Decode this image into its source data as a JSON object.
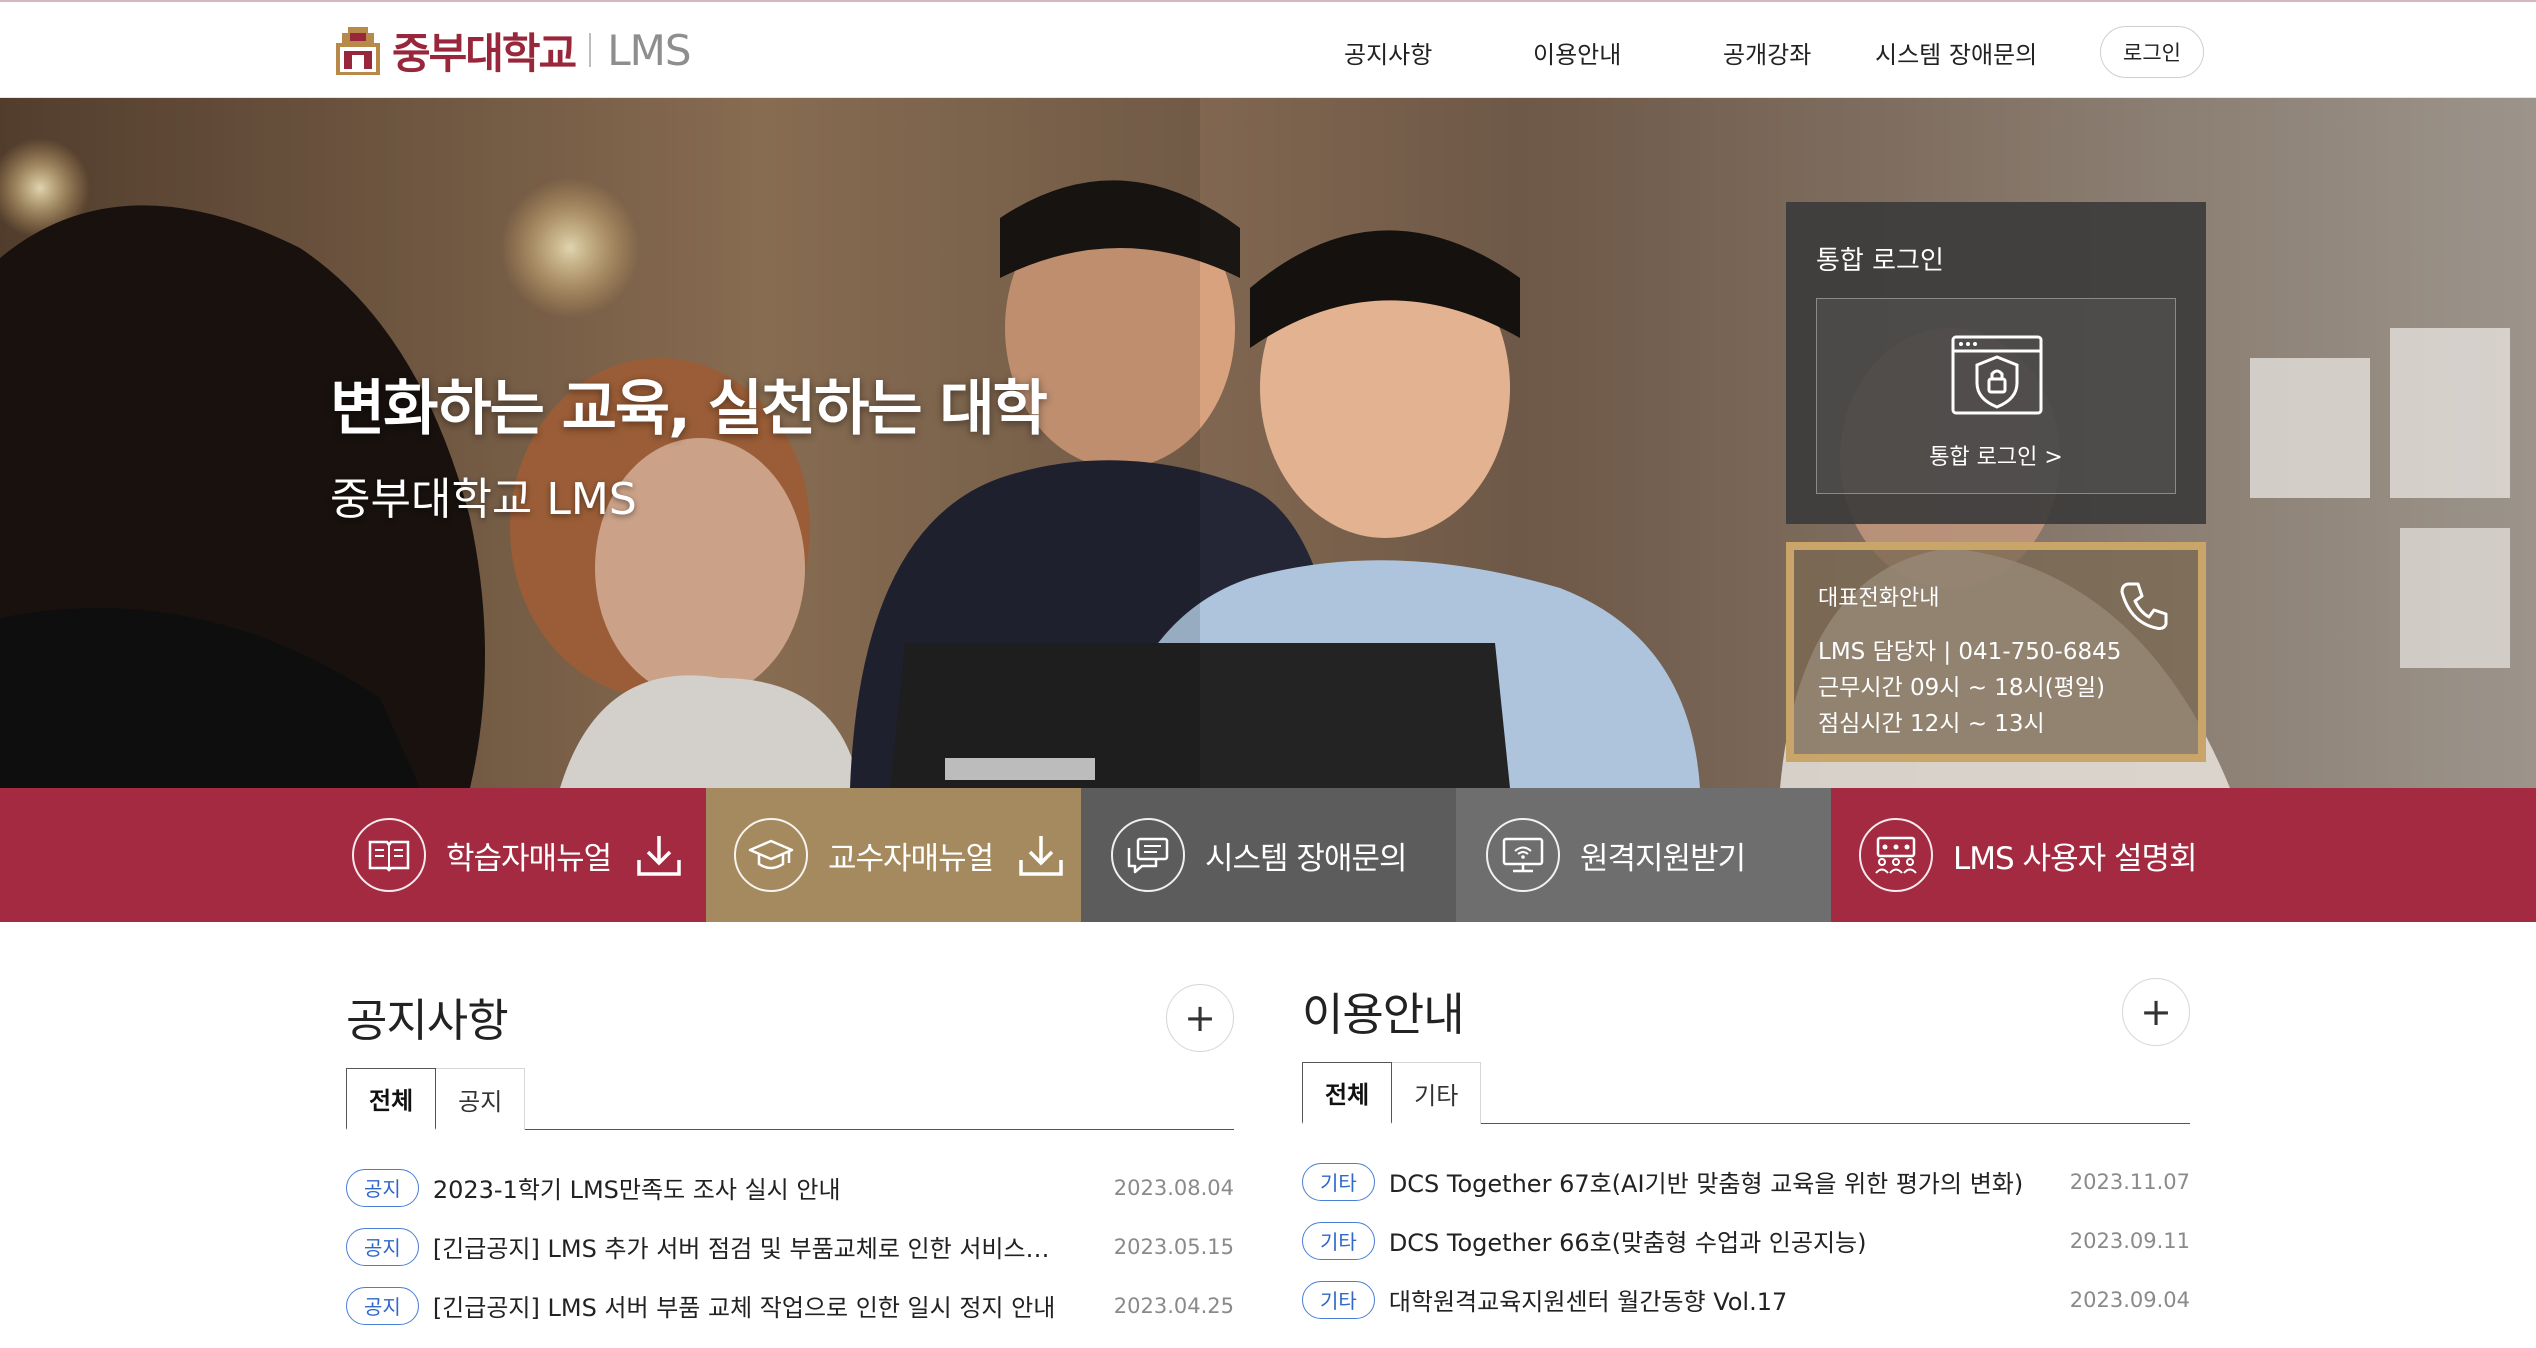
{
  "header": {
    "logo_name": "중부대학교",
    "logo_lms": "LMS",
    "nav": [
      {
        "label": "공지사항"
      },
      {
        "label": "이용안내"
      },
      {
        "label": "공개강좌"
      },
      {
        "label": "시스템 장애문의"
      }
    ],
    "login_button": "로그인"
  },
  "hero": {
    "title": "변화하는 교육, 실천하는 대학",
    "subtitle": "중부대학교 LMS",
    "login_box": {
      "title": "통합 로그인",
      "button_label": "통합 로그인 >"
    },
    "phone_box": {
      "title": "대표전화안내",
      "lines": [
        "LMS 담당자 | 041-750-6845",
        "근무시간 09시 ~ 18시(평일)",
        "점심시간 12시 ~ 13시"
      ]
    }
  },
  "quick_links": [
    {
      "label": "학습자매뉴얼",
      "icon": "book-icon",
      "download": true,
      "color": "#a32a40"
    },
    {
      "label": "교수자매뉴얼",
      "icon": "graduation-cap-icon",
      "download": true,
      "color": "#a68a5f"
    },
    {
      "label": "시스템 장애문의",
      "icon": "chat-icon",
      "download": false,
      "color": "#5c5c5c"
    },
    {
      "label": "원격지원받기",
      "icon": "monitor-icon",
      "download": false,
      "color": "#6e6e6e"
    },
    {
      "label": "LMS 사용자 설명회",
      "icon": "people-icon",
      "download": false,
      "color": "#a32a40"
    }
  ],
  "notice": {
    "title": "공지사항",
    "tabs": [
      "전체",
      "공지"
    ],
    "items": [
      {
        "badge": "공지",
        "title": "2023-1학기 LMS만족도 조사 실시 안내",
        "date": "2023.08.04"
      },
      {
        "badge": "공지",
        "title": "[긴급공지] LMS 추가 서버 점검 및 부품교체로 인한 서비스…",
        "date": "2023.05.15"
      },
      {
        "badge": "공지",
        "title": "[긴급공지] LMS 서버 부품 교체 작업으로 인한 일시 정지 안내",
        "date": "2023.04.25"
      }
    ]
  },
  "guide": {
    "title": "이용안내",
    "tabs": [
      "전체",
      "기타"
    ],
    "items": [
      {
        "badge": "기타",
        "title": "DCS Together 67호(AI기반 맞춤형 교육을 위한 평가의 변화)",
        "date": "2023.11.07"
      },
      {
        "badge": "기타",
        "title": "DCS Together 66호(맞춤형 수업과 인공지능)",
        "date": "2023.09.11"
      },
      {
        "badge": "기타",
        "title": "대학원격교육지원센터 월간동향 Vol.17",
        "date": "2023.09.04"
      }
    ]
  },
  "colors": {
    "brand": "#98273b",
    "badge_blue": "#2f68c9",
    "gold": "#c9a56a"
  }
}
